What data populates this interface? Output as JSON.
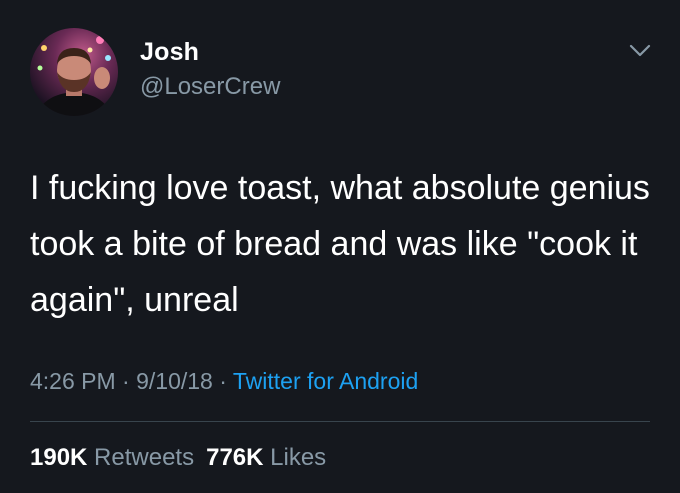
{
  "tweet": {
    "user": {
      "display_name": "Josh",
      "handle": "@LoserCrew",
      "avatar_icon": "profile-photo"
    },
    "menu_icon": "chevron-down-icon",
    "text": "I fucking love toast, what absolute genius took a bite of bread and was like \"cook it again\", unreal",
    "time": "4:26 PM",
    "separator": "·",
    "date": "9/10/18",
    "source": "Twitter for Android",
    "retweets_count": "190K",
    "retweets_label": "Retweets",
    "likes_count": "776K",
    "likes_label": "Likes"
  },
  "colors": {
    "background": "#15181e",
    "primary_text": "#ffffff",
    "secondary_text": "#8899a6",
    "link": "#1da1f2",
    "divider": "#38444d"
  }
}
